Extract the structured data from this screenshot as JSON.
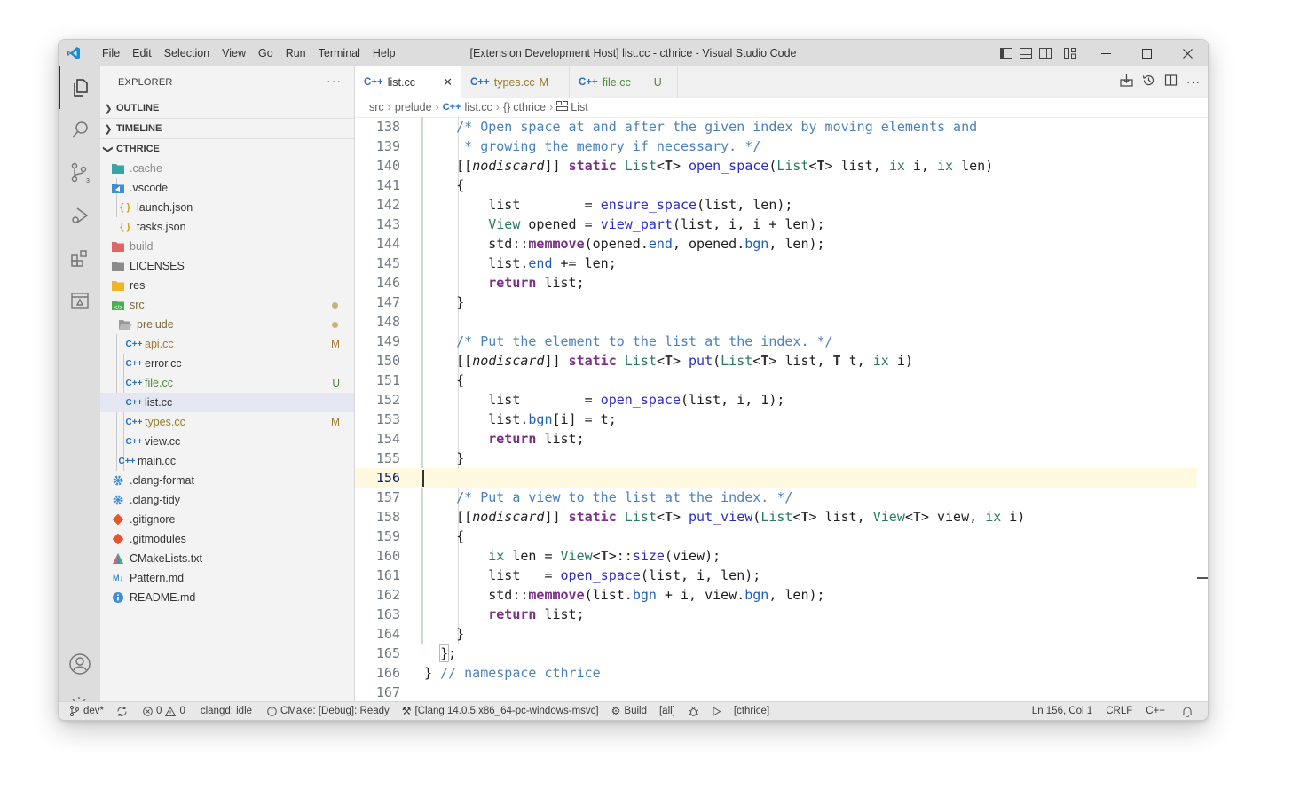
{
  "title_bar": {
    "menu": [
      "File",
      "Edit",
      "Selection",
      "View",
      "Go",
      "Run",
      "Terminal",
      "Help"
    ],
    "title": "[Extension Development Host] list.cc - cthrice - Visual Studio Code"
  },
  "sidebar": {
    "header": "EXPLORER",
    "sections": {
      "outline": "OUTLINE",
      "timeline": "TIMELINE",
      "project": "CTHRICE"
    },
    "tree": [
      {
        "label": ".cache",
        "badge": ""
      },
      {
        "label": ".vscode",
        "badge": ""
      },
      {
        "label": "launch.json",
        "badge": ""
      },
      {
        "label": "tasks.json",
        "badge": ""
      },
      {
        "label": "build",
        "badge": ""
      },
      {
        "label": "LICENSES",
        "badge": ""
      },
      {
        "label": "res",
        "badge": ""
      },
      {
        "label": "src",
        "badge": ""
      },
      {
        "label": "prelude",
        "badge": ""
      },
      {
        "label": "api.cc",
        "badge": "M"
      },
      {
        "label": "error.cc",
        "badge": ""
      },
      {
        "label": "file.cc",
        "badge": "U"
      },
      {
        "label": "list.cc",
        "badge": ""
      },
      {
        "label": "types.cc",
        "badge": "M"
      },
      {
        "label": "view.cc",
        "badge": ""
      },
      {
        "label": "main.cc",
        "badge": ""
      },
      {
        "label": ".clang-format",
        "badge": ""
      },
      {
        "label": ".clang-tidy",
        "badge": ""
      },
      {
        "label": ".gitignore",
        "badge": ""
      },
      {
        "label": ".gitmodules",
        "badge": ""
      },
      {
        "label": "CMakeLists.txt",
        "badge": ""
      },
      {
        "label": "Pattern.md",
        "badge": ""
      },
      {
        "label": "README.md",
        "badge": ""
      }
    ]
  },
  "tabs": [
    {
      "label": "list.cc",
      "badge": ""
    },
    {
      "label": "types.cc",
      "badge": "M"
    },
    {
      "label": "file.cc",
      "badge": "U"
    }
  ],
  "tab_icon_text": "C++",
  "breadcrumb": [
    "src",
    "prelude",
    "list.cc",
    "cthrice",
    "List"
  ],
  "line_numbers": [
    "138",
    "139",
    "140",
    "141",
    "142",
    "143",
    "144",
    "145",
    "146",
    "147",
    "148",
    "149",
    "150",
    "151",
    "152",
    "153",
    "154",
    "155",
    "156",
    "157",
    "158",
    "159",
    "160",
    "161",
    "162",
    "163",
    "164",
    "165",
    "166",
    "167"
  ],
  "status_bar": {
    "branch": "dev*",
    "errors": "0",
    "warnings": "0",
    "clangd": "clangd: idle",
    "cmake": "CMake: [Debug]: Ready",
    "kit": "[Clang 14.0.5 x86_64-pc-windows-msvc]",
    "build": "Build",
    "target": "[all]",
    "launch_target": "[cthrice]",
    "position": "Ln 156, Col 1",
    "eol": "CRLF",
    "language": "C++"
  },
  "colors": {
    "modified": "#9c7b2c",
    "untracked": "#4b8a3c",
    "cpp_icon": "#2a6fb8",
    "current_line": "#fff9e0"
  }
}
